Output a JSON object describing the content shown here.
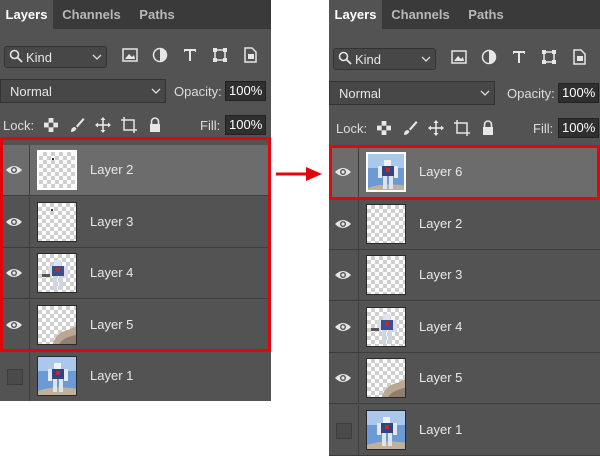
{
  "tabs": [
    "Layers",
    "Channels",
    "Paths"
  ],
  "kind_filter": "Kind",
  "blend_mode": "Normal",
  "opacity_label": "Opacity:",
  "opacity_value": "100%",
  "lock_label": "Lock:",
  "fill_label": "Fill:",
  "fill_value": "100%",
  "before": {
    "layers": [
      {
        "name": "Layer 2",
        "visible": true,
        "selected": true,
        "thumb": "speck"
      },
      {
        "name": "Layer 3",
        "visible": true,
        "selected": false,
        "thumb": "speck"
      },
      {
        "name": "Layer 4",
        "visible": true,
        "selected": false,
        "thumb": "robot"
      },
      {
        "name": "Layer 5",
        "visible": true,
        "selected": false,
        "thumb": "smoke"
      },
      {
        "name": "Layer 1",
        "visible": false,
        "selected": false,
        "thumb": "photo"
      }
    ]
  },
  "after": {
    "layers": [
      {
        "name": "Layer 6",
        "visible": true,
        "selected": true,
        "thumb": "merged"
      },
      {
        "name": "Layer 2",
        "visible": true,
        "selected": false,
        "thumb": "empty"
      },
      {
        "name": "Layer 3",
        "visible": true,
        "selected": false,
        "thumb": "empty"
      },
      {
        "name": "Layer 4",
        "visible": true,
        "selected": false,
        "thumb": "robot"
      },
      {
        "name": "Layer 5",
        "visible": true,
        "selected": false,
        "thumb": "smoke"
      },
      {
        "name": "Layer 1",
        "visible": false,
        "selected": false,
        "thumb": "photo"
      }
    ]
  },
  "colors": {
    "highlight": "#e0060b",
    "panel": "#535353",
    "selected_row": "#6c6c6c"
  }
}
